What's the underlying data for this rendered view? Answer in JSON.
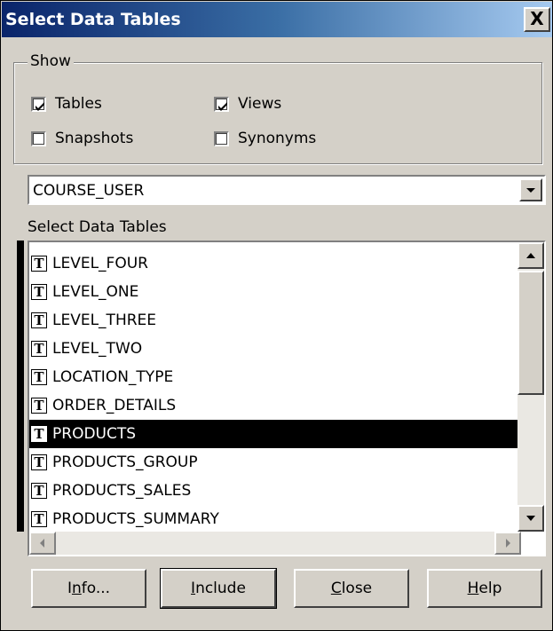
{
  "window": {
    "title": "Select Data Tables",
    "close_glyph": "X"
  },
  "show_group": {
    "label": "Show",
    "options": [
      {
        "label": "Tables",
        "checked": true
      },
      {
        "label": "Views",
        "checked": true
      },
      {
        "label": "Snapshots",
        "checked": false
      },
      {
        "label": "Synonyms",
        "checked": false
      }
    ]
  },
  "owner_select": {
    "value": "COURSE_USER",
    "arrow_icon": "chevron-down-icon"
  },
  "tables_list": {
    "label": "Select Data Tables",
    "icon_glyph": "T",
    "items": [
      "LEVEL_FOUR",
      "LEVEL_ONE",
      "LEVEL_THREE",
      "LEVEL_TWO",
      "LOCATION_TYPE",
      "ORDER_DETAILS",
      "PRODUCTS",
      "PRODUCTS_GROUP",
      "PRODUCTS_SALES",
      "PRODUCTS_SUMMARY"
    ],
    "selected": "PRODUCTS"
  },
  "buttons": {
    "info": {
      "pre": "I",
      "mn": "n",
      "post": "fo..."
    },
    "include": {
      "pre": "",
      "mn": "I",
      "post": "nclude"
    },
    "close": {
      "pre": "",
      "mn": "C",
      "post": "lose"
    },
    "help": {
      "pre": "",
      "mn": "H",
      "post": "elp"
    }
  }
}
